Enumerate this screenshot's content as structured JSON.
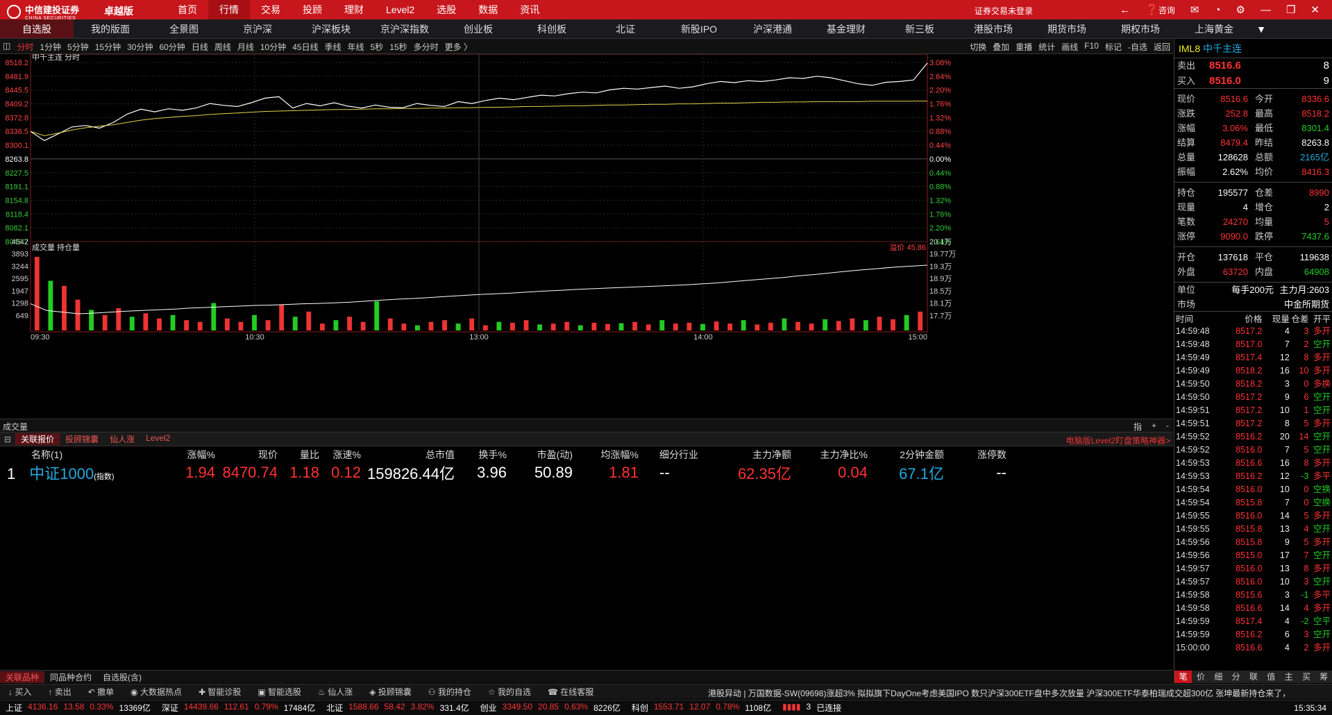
{
  "app": {
    "brand_cn": "中信建投证券",
    "brand_en": "CHINA SECURITIES",
    "edition": "卓越版",
    "login_status": "证券交易未登录",
    "service": "咨询"
  },
  "top_menu": [
    "首页",
    "行情",
    "交易",
    "投顾",
    "理财",
    "Level2",
    "选股",
    "数据",
    "资讯"
  ],
  "top_menu_active": 1,
  "market_tabs": [
    "自选股",
    "我的版面",
    "全景图",
    "京沪深",
    "沪深板块",
    "京沪深指数",
    "创业板",
    "科创板",
    "北证",
    "新股IPO",
    "沪深港通",
    "基金理财",
    "新三板",
    "港股市场",
    "期货市场",
    "期权市场",
    "上海黄金"
  ],
  "market_tabs_active": 0,
  "period_tools": [
    "分时",
    "1分钟",
    "5分钟",
    "15分钟",
    "30分钟",
    "60分钟",
    "日线",
    "周线",
    "月线",
    "10分钟",
    "45日线",
    "季线",
    "年线",
    "5秒",
    "15秒",
    "多分时",
    "更多 〉"
  ],
  "period_active": 0,
  "right_tools": [
    "切换",
    "叠加",
    "重播",
    "统计",
    "画线",
    "F10",
    "标记",
    "-自选",
    "返回"
  ],
  "chart_data": [
    {
      "type": "line",
      "title": "中千主连  分时",
      "x_ticks": [
        "09:30",
        "10:30",
        "13:00",
        "14:00",
        "15:00"
      ],
      "y_left_ticks": [
        "8518.2",
        "8481.9",
        "8445.5",
        "8409.2",
        "8372.8",
        "8336.5",
        "8300.1",
        "8263.8",
        "8227.5",
        "8191.1",
        "8154.8",
        "8118.4",
        "8082.1",
        "8045.7"
      ],
      "y_right_ticks": [
        "3.08%",
        "2.64%",
        "2.20%",
        "1.76%",
        "1.32%",
        "0.88%",
        "0.44%",
        "0.00%",
        "0.44%",
        "0.88%",
        "1.32%",
        "1.76%",
        "2.20%",
        "2.64%"
      ],
      "ylim": [
        8045.7,
        8518.2
      ],
      "prev_settle": 8263.8,
      "series": [
        {
          "color": "#ffffff",
          "values": [
            8336.5,
            8312,
            8330,
            8348,
            8352,
            8345,
            8360,
            8382,
            8395,
            8388,
            8396,
            8392,
            8398,
            8410,
            8405,
            8402,
            8412,
            8424,
            8428,
            8398,
            8410,
            8404,
            8412,
            8403,
            8398,
            8406,
            8400,
            8399,
            8410,
            8405,
            8402,
            8415,
            8410,
            8418,
            8424,
            8420,
            8426,
            8432,
            8430,
            8436,
            8440,
            8438,
            8446,
            8450,
            8448,
            8452,
            8456,
            8450,
            8454,
            8462,
            8468,
            8465,
            8470,
            8468,
            8472,
            8478,
            8476,
            8482,
            8478,
            8470,
            8462,
            8458,
            8466,
            8468,
            8472,
            8516.6
          ]
        },
        {
          "color": "#e6d34a",
          "values": [
            8336.5,
            8325,
            8332,
            8340,
            8346,
            8350,
            8354,
            8360,
            8366,
            8370,
            8373,
            8376,
            8378,
            8381,
            8383,
            8385,
            8387,
            8389,
            8390,
            8391,
            8392,
            8393,
            8394,
            8394,
            8395,
            8396,
            8396,
            8397,
            8397,
            8398,
            8398,
            8399,
            8399,
            8400,
            8400,
            8401,
            8402,
            8402,
            8403,
            8404,
            8404,
            8405,
            8406,
            8406,
            8407,
            8408,
            8408,
            8409,
            8409,
            8410,
            8411,
            8411,
            8412,
            8413,
            8413,
            8414,
            8414,
            8415,
            8415,
            8415,
            8415,
            8416,
            8416,
            8416,
            8416,
            8416.3
          ]
        }
      ]
    },
    {
      "type": "bar",
      "title": "成交量  持仓量",
      "annotation": "溢价 45.86",
      "y_left_ticks": [
        "4542",
        "3893",
        "3244",
        "2595",
        "1947",
        "1298",
        "649"
      ],
      "y_right_ticks": [
        "20.1万",
        "19.77万",
        "19.3万",
        "18.9万",
        "18.5万",
        "18.1万",
        "17.7万"
      ],
      "volume_max": 4542,
      "volume": [
        4300,
        2900,
        2600,
        1800,
        1200,
        900,
        1300,
        800,
        1000,
        700,
        900,
        600,
        500,
        1600,
        700,
        500,
        900,
        600,
        1500,
        800,
        1100,
        400,
        600,
        800,
        500,
        1700,
        700,
        400,
        300,
        500,
        600,
        400,
        700,
        300,
        500,
        450,
        600,
        350,
        400,
        500,
        300,
        450,
        380,
        420,
        500,
        350,
        600,
        400,
        450,
        380,
        520,
        400,
        600,
        350,
        450,
        700,
        500,
        400,
        650,
        550,
        700,
        600,
        800,
        650,
        900,
        1100
      ],
      "open_interest_lim": [
        176000,
        201000
      ],
      "open_interest": [
        184000,
        182000,
        181500,
        181000,
        181200,
        181500,
        181800,
        182000,
        182200,
        182400,
        182700,
        182900,
        183100,
        183300,
        183500,
        183600,
        183800,
        184000,
        184100,
        184300,
        184500,
        184800,
        185100,
        185400,
        185600,
        185900,
        186200,
        186500,
        186800,
        187000,
        187200,
        187500,
        187800,
        188000,
        188300,
        188500,
        188700,
        188900,
        189100,
        189300,
        189500,
        189700,
        190000,
        190300,
        190700,
        191100,
        191500,
        191900,
        192400,
        192800,
        193300,
        193800,
        194200,
        194600,
        195000,
        195300,
        195577
      ]
    }
  ],
  "volume_caption": "成交量",
  "vol_tools": [
    "指",
    "+",
    "-"
  ],
  "sub_tabs": [
    "关联报价",
    "投顾锦囊",
    "仙人涨",
    "Level2"
  ],
  "sub_tabs_active": 0,
  "sub_ad": "电脑版Level2盯盘策略神器>",
  "table": {
    "headers": [
      "名称(1)",
      "涨幅%",
      "现价",
      "量比",
      "涨速%",
      "总市值",
      "换手%",
      "市盈(动)",
      "均涨幅%",
      "细分行业",
      "主力净额",
      "主力净比%",
      "2分钟金额",
      "涨停数"
    ],
    "row": {
      "idx": "1",
      "name": "中证1000",
      "tag": "(指数)",
      "change": "1.94",
      "price": "8470.74",
      "vol_ratio": "1.18",
      "speed": "0.12",
      "mcap": "159826.44亿",
      "turnover": "3.96",
      "pe": "50.89",
      "avg_chg": "1.81",
      "industry": "--",
      "net": "62.35亿",
      "net_ratio": "0.04",
      "amt2": "67.1亿",
      "limit_up": "--"
    }
  },
  "quote": {
    "code": "IML8",
    "name": "中千主连",
    "sell_label": "卖出",
    "sell_price": "8516.6",
    "sell_vol": "8",
    "buy_label": "买入",
    "buy_price": "8516.0",
    "buy_vol": "9",
    "rows": [
      [
        "现价",
        "8516.6",
        "今开",
        "8336.6"
      ],
      [
        "涨跌",
        "252.8",
        "最高",
        "8518.2"
      ],
      [
        "涨幅",
        "3.06%",
        "最低",
        "8301.4"
      ],
      [
        "结算",
        "8479.4",
        "昨结",
        "8263.8"
      ],
      [
        "总量",
        "128628",
        "总额",
        "2165亿"
      ],
      [
        "振幅",
        "2.62%",
        "均价",
        "8416.3"
      ]
    ],
    "rows2": [
      [
        "持仓",
        "195577",
        "仓差",
        "8990"
      ],
      [
        "现量",
        "4",
        "增仓",
        "2"
      ],
      [
        "笔数",
        "24270",
        "均量",
        "5"
      ],
      [
        "涨停",
        "9090.0",
        "跌停",
        "7437.6"
      ]
    ],
    "rows3": [
      [
        "开仓",
        "137618",
        "平仓",
        "119638"
      ],
      [
        "外盘",
        "63720",
        "内盘",
        "64908"
      ]
    ],
    "unit_label": "单位",
    "unit_value": "每手200元",
    "main_label": "主力月:2603",
    "market_label": "市场",
    "market_value": "中金所期货"
  },
  "ticks_header": [
    "时间",
    "价格",
    "现量",
    "仓差",
    "开平"
  ],
  "ticks": [
    [
      "14:59:48",
      "8517.2",
      "4",
      "3",
      "多开"
    ],
    [
      "14:59:48",
      "8517.0",
      "7",
      "2",
      "空开"
    ],
    [
      "14:59:49",
      "8517.4",
      "12",
      "8",
      "多开"
    ],
    [
      "14:59:49",
      "8518.2",
      "16",
      "10",
      "多开"
    ],
    [
      "14:59:50",
      "8518.2",
      "3",
      "0",
      "多换"
    ],
    [
      "14:59:50",
      "8517.2",
      "9",
      "6",
      "空开"
    ],
    [
      "14:59:51",
      "8517.2",
      "10",
      "1",
      "空开"
    ],
    [
      "14:59:51",
      "8517.2",
      "8",
      "5",
      "多开"
    ],
    [
      "14:59:52",
      "8516.2",
      "20",
      "14",
      "空开"
    ],
    [
      "14:59:52",
      "8516.0",
      "7",
      "5",
      "空开"
    ],
    [
      "14:59:53",
      "8516.6",
      "16",
      "8",
      "多开"
    ],
    [
      "14:59:53",
      "8516.2",
      "12",
      "-3",
      "多平"
    ],
    [
      "14:59:54",
      "8516.0",
      "10",
      "0",
      "空换"
    ],
    [
      "14:59:54",
      "8515.8",
      "7",
      "0",
      "空换"
    ],
    [
      "14:59:55",
      "8516.0",
      "14",
      "5",
      "多开"
    ],
    [
      "14:59:55",
      "8515.8",
      "13",
      "4",
      "空开"
    ],
    [
      "14:59:56",
      "8515.8",
      "9",
      "5",
      "多开"
    ],
    [
      "14:59:56",
      "8515.0",
      "17",
      "7",
      "空开"
    ],
    [
      "14:59:57",
      "8516.0",
      "13",
      "8",
      "多开"
    ],
    [
      "14:59:57",
      "8516.0",
      "10",
      "3",
      "空开"
    ],
    [
      "14:59:58",
      "8515.6",
      "3",
      "-1",
      "多平"
    ],
    [
      "14:59:58",
      "8516.6",
      "14",
      "4",
      "多开"
    ],
    [
      "14:59:59",
      "8517.4",
      "4",
      "-2",
      "空平"
    ],
    [
      "14:59:59",
      "8516.2",
      "6",
      "3",
      "空开"
    ],
    [
      "15:00:00",
      "8516.6",
      "4",
      "2",
      "多开"
    ]
  ],
  "right_tabs": [
    "笔",
    "价",
    "细",
    "分",
    "联",
    "值",
    "主",
    "买",
    "筹"
  ],
  "bottom_tabs": [
    "关联品种",
    "同品种合约",
    "自选股(含)"
  ],
  "actions": [
    "买入",
    "卖出",
    "撤单",
    "大数据热点",
    "智能诊股",
    "智能选股",
    "仙人涨",
    "投顾锦囊",
    "我的持仓",
    "我的自选",
    "在线客服"
  ],
  "news": "港股异动 | 万国数据-SW(09698)涨超3% 拟拟旗下DayOne考虑美国IPO      数只沪深300ETF盘中多次放量 沪深300ETF华泰柏瑞成交超300亿      张坤最新持仓来了，",
  "status": {
    "sh": [
      "上证",
      "4136.16",
      "13.58",
      "0.33%",
      "13369亿"
    ],
    "sz": [
      "深证",
      "14439.66",
      "112.61",
      "0.79%",
      "17484亿"
    ],
    "bz": [
      "北证",
      "1588.66",
      "58.42",
      "3.82%",
      "331.4亿"
    ],
    "cy": [
      "创业",
      "3349.50",
      "20.85",
      "0.63%",
      "8226亿"
    ],
    "kc": [
      "科创",
      "1553.71",
      "12.07",
      "0.78%",
      "1108亿"
    ],
    "conn": "已连接",
    "conn_count": "3",
    "time": "15:35:34"
  }
}
